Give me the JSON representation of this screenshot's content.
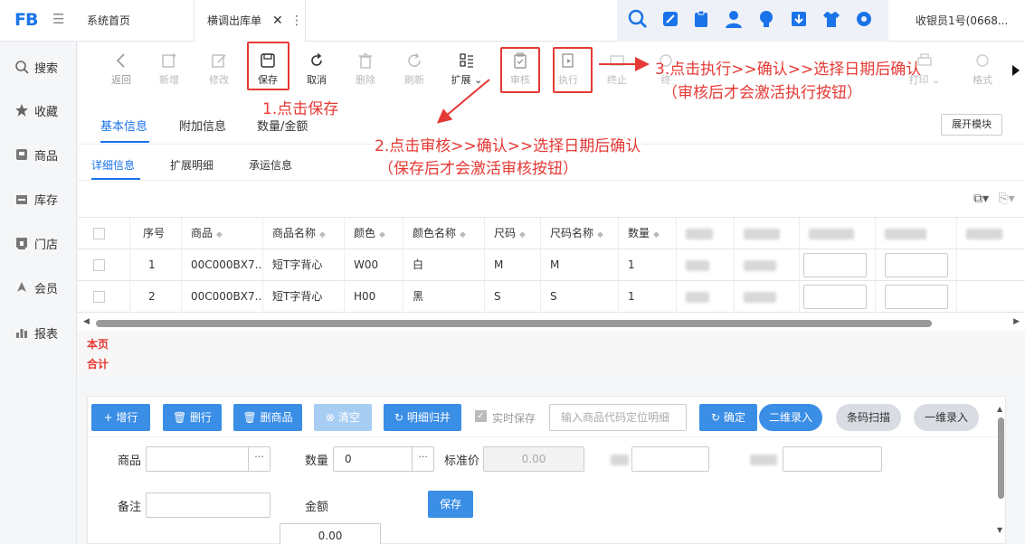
{
  "topbar": {
    "logo": "FB",
    "tabs": [
      {
        "label": "系统首页"
      },
      {
        "label": "横调出库单"
      }
    ],
    "close_glyph": "✕",
    "more_glyph": "⋮",
    "user": "收银员1号(0668...",
    "icons": [
      "search-icon",
      "edit-icon",
      "clipboard-icon",
      "user-icon",
      "bulb-icon",
      "download-icon",
      "shirt-icon",
      "gear-icon"
    ]
  },
  "sidebar": {
    "items": [
      {
        "label": "搜索",
        "icon": "search-icon"
      },
      {
        "label": "收藏",
        "icon": "star-icon"
      },
      {
        "label": "商品",
        "icon": "goods-icon"
      },
      {
        "label": "库存",
        "icon": "stock-icon"
      },
      {
        "label": "门店",
        "icon": "store-icon"
      },
      {
        "label": "会员",
        "icon": "member-icon"
      },
      {
        "label": "报表",
        "icon": "report-icon"
      }
    ]
  },
  "toolbar": {
    "buttons": [
      {
        "label": "返回"
      },
      {
        "label": "新增"
      },
      {
        "label": "修改"
      },
      {
        "label": "保存"
      },
      {
        "label": "取消"
      },
      {
        "label": "删除"
      },
      {
        "label": "刷新"
      },
      {
        "label": "扩展 ⌄"
      },
      {
        "label": "审核"
      },
      {
        "label": "执行"
      },
      {
        "label": "终止"
      },
      {
        "label": "终"
      },
      {
        "label": "打印 ⌄"
      },
      {
        "label": "格式"
      }
    ]
  },
  "section_tabs": [
    {
      "label": "基本信息"
    },
    {
      "label": "附加信息"
    },
    {
      "label": "数量/金额"
    }
  ],
  "expand_label": "展开模块",
  "sub_tabs": [
    {
      "label": "详细信息"
    },
    {
      "label": "扩展明细"
    },
    {
      "label": "承运信息"
    }
  ],
  "grid": {
    "headers": [
      "序号",
      "商品",
      "商品名称",
      "颜色",
      "颜色名称",
      "尺码",
      "尺码名称",
      "数量"
    ],
    "rows": [
      {
        "no": "1",
        "code": "00C000BX7...",
        "name": "短T字背心",
        "color": "W00",
        "color_name": "白",
        "size": "M",
        "size_name": "M",
        "qty": "1"
      },
      {
        "no": "2",
        "code": "00C000BX7...",
        "name": "短T字背心",
        "color": "H00",
        "color_name": "黑",
        "size": "S",
        "size_name": "S",
        "qty": "1"
      }
    ],
    "footer": [
      "本页",
      "合计"
    ]
  },
  "editor": {
    "buttons": {
      "add_row": "+ 增行",
      "del_row": "删行",
      "del_goods": "删商品",
      "clear": "清空",
      "merge": "明细归并",
      "realtime_save": "实时保存",
      "confirm": "确定",
      "qr_entry": "二维录入",
      "barcode_scan": "条码扫描",
      "one_d_entry": "一维录入",
      "save": "保存"
    },
    "search_placeholder": "输入商品代码定位明细",
    "fields": {
      "goods_label": "商品",
      "qty_label": "数量",
      "qty_value": "0",
      "std_price_label": "标准价",
      "std_price_value": "0.00",
      "remark_label": "备注",
      "amount_label": "金额",
      "amount_value": "0.00"
    }
  },
  "annotations": {
    "step1": "1.点击保存",
    "step2_line1": "2.点击审核>>确认>>选择日期后确认",
    "step2_line2": "（保存后才会激活审核按钮）",
    "step3_line1": "3.点击执行>>确认>>选择日期后确认",
    "step3_line2": "（审核后才会激活执行按钮）"
  },
  "colors": {
    "accent": "#1a73e8",
    "annotation": "#e53935",
    "button": "#3a8ee6"
  }
}
